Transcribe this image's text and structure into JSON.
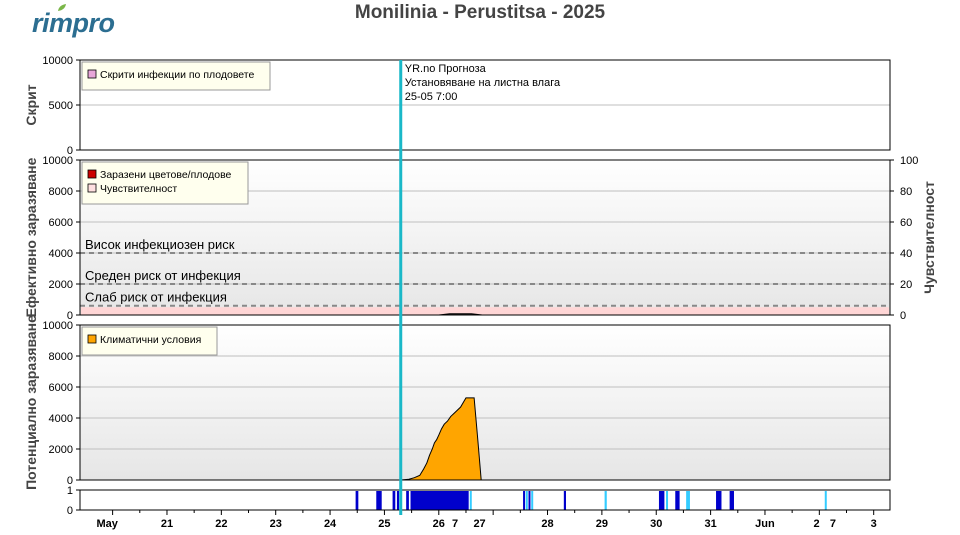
{
  "brand": {
    "logo_text": "rimpro",
    "leaf_color": "#7ab648",
    "text_color": "#2c6e91"
  },
  "title": "Monilinia - Perustitsa - 2025",
  "chart_data": [
    {
      "type": "area",
      "panel": "scab",
      "ylabel": "Скрит",
      "ylim": [
        0,
        10000
      ],
      "y_ticks": [
        "0",
        "5000",
        "10000"
      ],
      "legend": [
        {
          "label": "Скрити инфекции по плодовете",
          "color": "#e8a6d8"
        }
      ],
      "series": []
    },
    {
      "type": "area",
      "panel": "effective",
      "ylabel": "Ефективно заразяване",
      "ylabel_right": "Чувствителност",
      "ylim": [
        0,
        10000
      ],
      "ylim_right": [
        0,
        100
      ],
      "y_ticks": [
        "0",
        "2000",
        "4000",
        "6000",
        "8000",
        "10000"
      ],
      "y_ticks_right": [
        "0",
        "20",
        "40",
        "60",
        "80",
        "100"
      ],
      "legend": [
        {
          "label": "Заразени цветове/плодове",
          "color": "#cc0000"
        },
        {
          "label": "Чувствителност",
          "color": "#ffe0e0"
        }
      ],
      "thresholds": [
        {
          "label": "Висок инфекциозен риск",
          "value": 4000
        },
        {
          "label": "Среден риск от инфекция",
          "value": 2000
        },
        {
          "label": "Слаб риск от инфекция",
          "value": 600
        }
      ],
      "sensitivity_level": 5,
      "series": [
        {
          "name": "Заразени цветове/плодове",
          "x": [
            26.0,
            26.2,
            26.4,
            26.6,
            26.8
          ],
          "y": [
            0,
            80,
            80,
            80,
            0
          ]
        }
      ]
    },
    {
      "type": "area",
      "panel": "potential",
      "ylabel": "Потенциално заразяване",
      "ylim": [
        0,
        10000
      ],
      "y_ticks": [
        "0",
        "2000",
        "4000",
        "6000",
        "8000",
        "10000"
      ],
      "legend": [
        {
          "label": "Климатични условия",
          "color": "#ffa500"
        }
      ],
      "series": [
        {
          "name": "Климатични условия",
          "x": [
            25.3,
            25.45,
            25.55,
            25.65,
            25.72,
            25.78,
            25.83,
            25.88,
            25.92,
            25.96,
            26.0,
            26.05,
            26.1,
            26.16,
            26.22,
            26.28,
            26.34,
            26.4,
            26.45,
            26.5,
            26.55,
            26.6,
            26.65,
            26.72,
            26.78
          ],
          "y": [
            0,
            50,
            150,
            300,
            700,
            1100,
            1600,
            2000,
            2400,
            2600,
            2900,
            3300,
            3600,
            3800,
            4100,
            4300,
            4500,
            4700,
            5000,
            5300,
            5300,
            5300,
            5300,
            2500,
            0
          ]
        }
      ]
    },
    {
      "type": "bar",
      "panel": "wetness",
      "ylim": [
        0,
        1
      ],
      "y_ticks": [
        "0",
        "1"
      ],
      "colors": {
        "wet": "#0000cc",
        "light": "#33ccff"
      },
      "wet_periods": [
        [
          24.47,
          24.52,
          "wet"
        ],
        [
          24.85,
          24.95,
          "wet"
        ],
        [
          25.15,
          25.2,
          "wet"
        ],
        [
          25.23,
          25.27,
          "wet"
        ],
        [
          25.4,
          25.45,
          "wet"
        ],
        [
          25.48,
          26.55,
          "wet"
        ],
        [
          26.57,
          26.6,
          "light"
        ],
        [
          27.55,
          27.58,
          "wet"
        ],
        [
          27.6,
          27.63,
          "light"
        ],
        [
          27.65,
          27.68,
          "wet"
        ],
        [
          27.7,
          27.73,
          "light"
        ],
        [
          28.3,
          28.34,
          "wet"
        ],
        [
          29.05,
          29.09,
          "light"
        ],
        [
          30.05,
          30.15,
          "wet"
        ],
        [
          30.18,
          30.21,
          "light"
        ],
        [
          30.35,
          30.43,
          "wet"
        ],
        [
          30.55,
          30.62,
          "light"
        ],
        [
          31.1,
          31.2,
          "wet"
        ],
        [
          31.35,
          31.43,
          "wet"
        ],
        [
          33.1,
          33.13,
          "light"
        ]
      ]
    }
  ],
  "x_axis": {
    "range": [
      19.4,
      34.3
    ],
    "ticks": [
      {
        "label": "May",
        "x": 19.9,
        "bold": true
      },
      {
        "label": "21",
        "x": 21.0
      },
      {
        "label": "22",
        "x": 22.0
      },
      {
        "label": "23",
        "x": 23.0
      },
      {
        "label": "24",
        "x": 24.0
      },
      {
        "label": "25",
        "x": 25.0
      },
      {
        "label": "26",
        "x": 26.0
      },
      {
        "label": "7",
        "x": 26.3
      },
      {
        "label": "27",
        "x": 26.75
      },
      {
        "label": "28",
        "x": 28.0
      },
      {
        "label": "29",
        "x": 29.0
      },
      {
        "label": "30",
        "x": 30.0
      },
      {
        "label": "31",
        "x": 31.0
      },
      {
        "label": "Jun",
        "x": 32.0,
        "bold": true
      },
      {
        "label": "2",
        "x": 32.95
      },
      {
        "label": "7",
        "x": 33.25
      },
      {
        "label": "3",
        "x": 34.0
      }
    ]
  },
  "forecast": {
    "x": 25.3,
    "color": "#1ab8c8",
    "lines": [
      "YR.no Прогноза",
      "Установяване на листна влага",
      "25-05 7:00"
    ]
  }
}
